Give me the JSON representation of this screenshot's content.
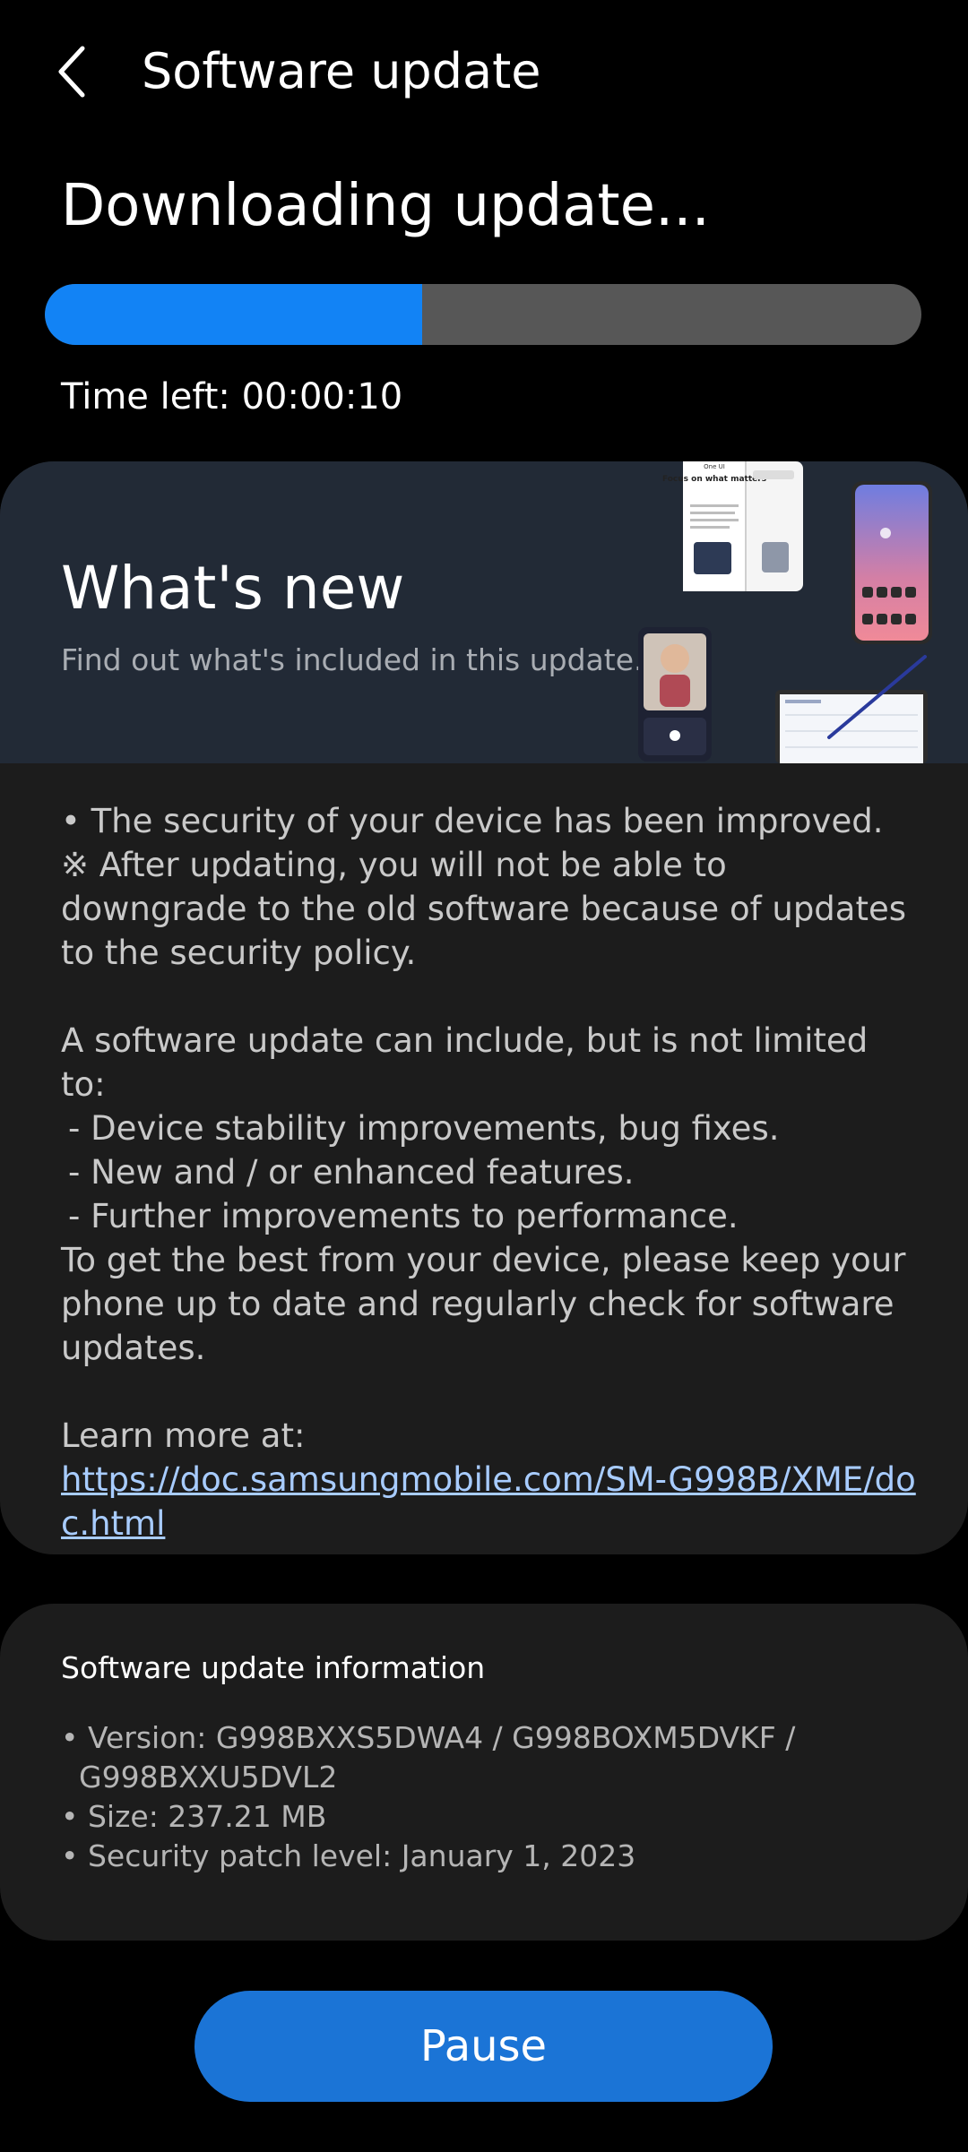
{
  "header": {
    "title": "Software update",
    "back_icon": "chevron-left-icon"
  },
  "status": {
    "title": "Downloading update...",
    "progress_fraction": 0.43,
    "time_left": "Time left: 00:00:10",
    "colors": {
      "progress_fill": "#1283f5",
      "progress_track": "#575757"
    }
  },
  "whats_new": {
    "title": "What's new",
    "subtitle": "Find out what's included in this update.",
    "notes": [
      "• The security of your device has been improved.",
      "※ After updating, you will not be able to downgrade to the old software because of updates to the security policy.",
      "A software update can include, but is not limited to:",
      " - Device stability improvements, bug fixes.",
      " - New and / or enhanced features.",
      " - Further improvements to performance.",
      "To get the best from your device, please keep your phone up to date and regularly check for software updates.",
      "Learn more at:"
    ],
    "link": "https://doc.samsungmobile.com/SM-G998B/XME/doc.html",
    "art_text": {
      "phone_heading": "One UI",
      "phone_tagline": "Focus on what matters"
    }
  },
  "info": {
    "title": "Software update information",
    "version": "• Version: G998BXXS5DWA4 / G998BOXM5DVKF /",
    "version_cont": "G998BXXU5DVL2",
    "size": "• Size: 237.21 MB",
    "security_patch": "• Security patch level: January 1, 2023"
  },
  "actions": {
    "pause_label": "Pause",
    "accent": "#1b74d6"
  }
}
